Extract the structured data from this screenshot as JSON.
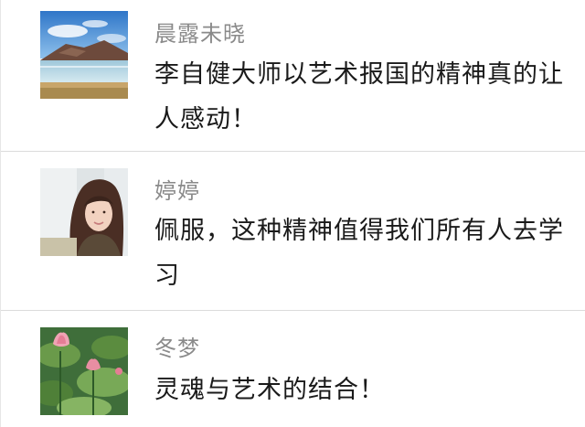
{
  "comments": [
    {
      "author": "晨露未晓",
      "text": "李自健大师以艺术报国的精神真的让人感动！",
      "avatar": "landscape-mountain-lake-avatar"
    },
    {
      "author": "婷婷",
      "text": "佩服，这种精神值得我们所有人去学习",
      "avatar": "woman-portrait-avatar"
    },
    {
      "author": "冬梦",
      "text": "灵魂与艺术的结合！",
      "avatar": "lotus-flower-avatar"
    }
  ],
  "colors": {
    "author": "#8a8a8a",
    "text": "#1a1a1a",
    "divider": "#dcdcdc"
  }
}
